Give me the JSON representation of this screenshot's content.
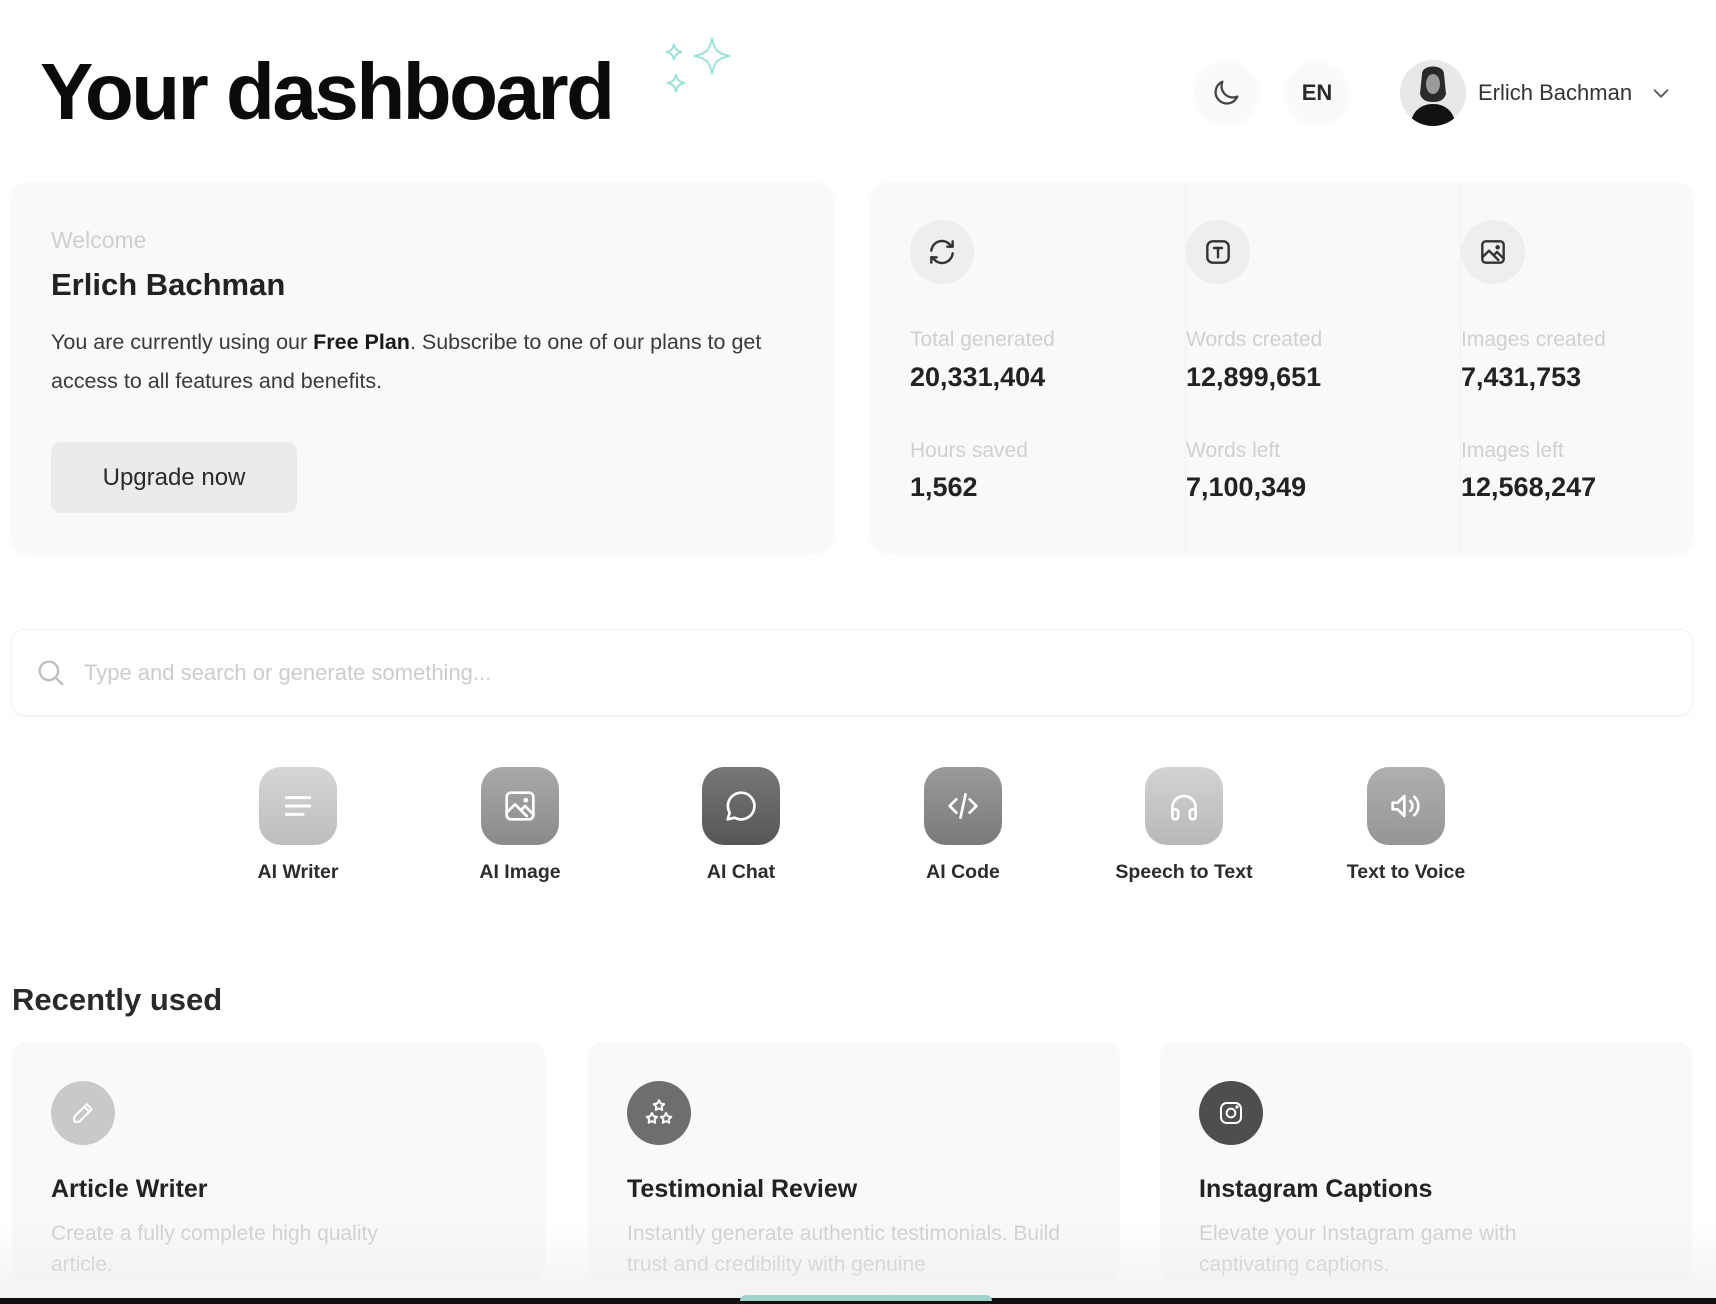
{
  "header": {
    "title": "Your dashboard",
    "sparkle_color": "#9fe0d8",
    "theme_toggle_icon": "moon-icon",
    "language": "EN",
    "user": {
      "name": "Erlich Bachman",
      "avatar_icon": "avatar",
      "menu_icon": "chevron-down-icon"
    }
  },
  "welcome": {
    "label": "Welcome",
    "name": "Erlich Bachman",
    "desc_pre": "You are currently using our ",
    "desc_plan": "Free Plan",
    "desc_post": ". Subscribe to one of our plans to get access to all features and benefits.",
    "upgrade_label": "Upgrade now"
  },
  "stats": [
    {
      "icon": "refresh-icon",
      "items": [
        {
          "label": "Total generated",
          "value": "20,331,404"
        },
        {
          "label": "Hours saved",
          "value": "1,562"
        }
      ]
    },
    {
      "icon": "text-icon",
      "items": [
        {
          "label": "Words created",
          "value": "12,899,651"
        },
        {
          "label": "Words left",
          "value": "7,100,349"
        }
      ]
    },
    {
      "icon": "image-icon",
      "items": [
        {
          "label": "Images created",
          "value": "7,431,753"
        },
        {
          "label": "Images left",
          "value": "12,568,247"
        }
      ]
    }
  ],
  "search": {
    "placeholder": "Type and search or generate something...",
    "value": ""
  },
  "apps": [
    {
      "label": "AI Writer",
      "icon": "lines-icon",
      "color_top": "#d6d6d6",
      "color_bottom": "#bdbdbd"
    },
    {
      "label": "AI Image",
      "icon": "image-icon",
      "color_top": "#a9a9a9",
      "color_bottom": "#8a8a8a"
    },
    {
      "label": "AI Chat",
      "icon": "chat-bubble-icon",
      "color_top": "#777777",
      "color_bottom": "#565656"
    },
    {
      "label": "AI Code",
      "icon": "code-icon",
      "color_top": "#9a9a9a",
      "color_bottom": "#7a7a7a"
    },
    {
      "label": "Speech to Text",
      "icon": "headphones-icon",
      "color_top": "#d3d3d3",
      "color_bottom": "#b8b8b8"
    },
    {
      "label": "Text to Voice",
      "icon": "speaker-icon",
      "color_top": "#b0b0b0",
      "color_bottom": "#959595"
    }
  ],
  "recently_used": {
    "title": "Recently used",
    "items": [
      {
        "title": "Article Writer",
        "desc": "Create a fully complete high quality article.",
        "icon": "pencil-icon",
        "color": "#c9c9c9"
      },
      {
        "title": "Testimonial Review",
        "desc": "Instantly generate authentic testimonials. Build trust and credibility with genuine",
        "icon": "stars-icon",
        "color": "#6e6e6e"
      },
      {
        "title": "Instagram Captions",
        "desc": "Elevate your Instagram game with captivating captions.",
        "icon": "instagram-icon",
        "color": "#4e4e4e"
      }
    ]
  }
}
